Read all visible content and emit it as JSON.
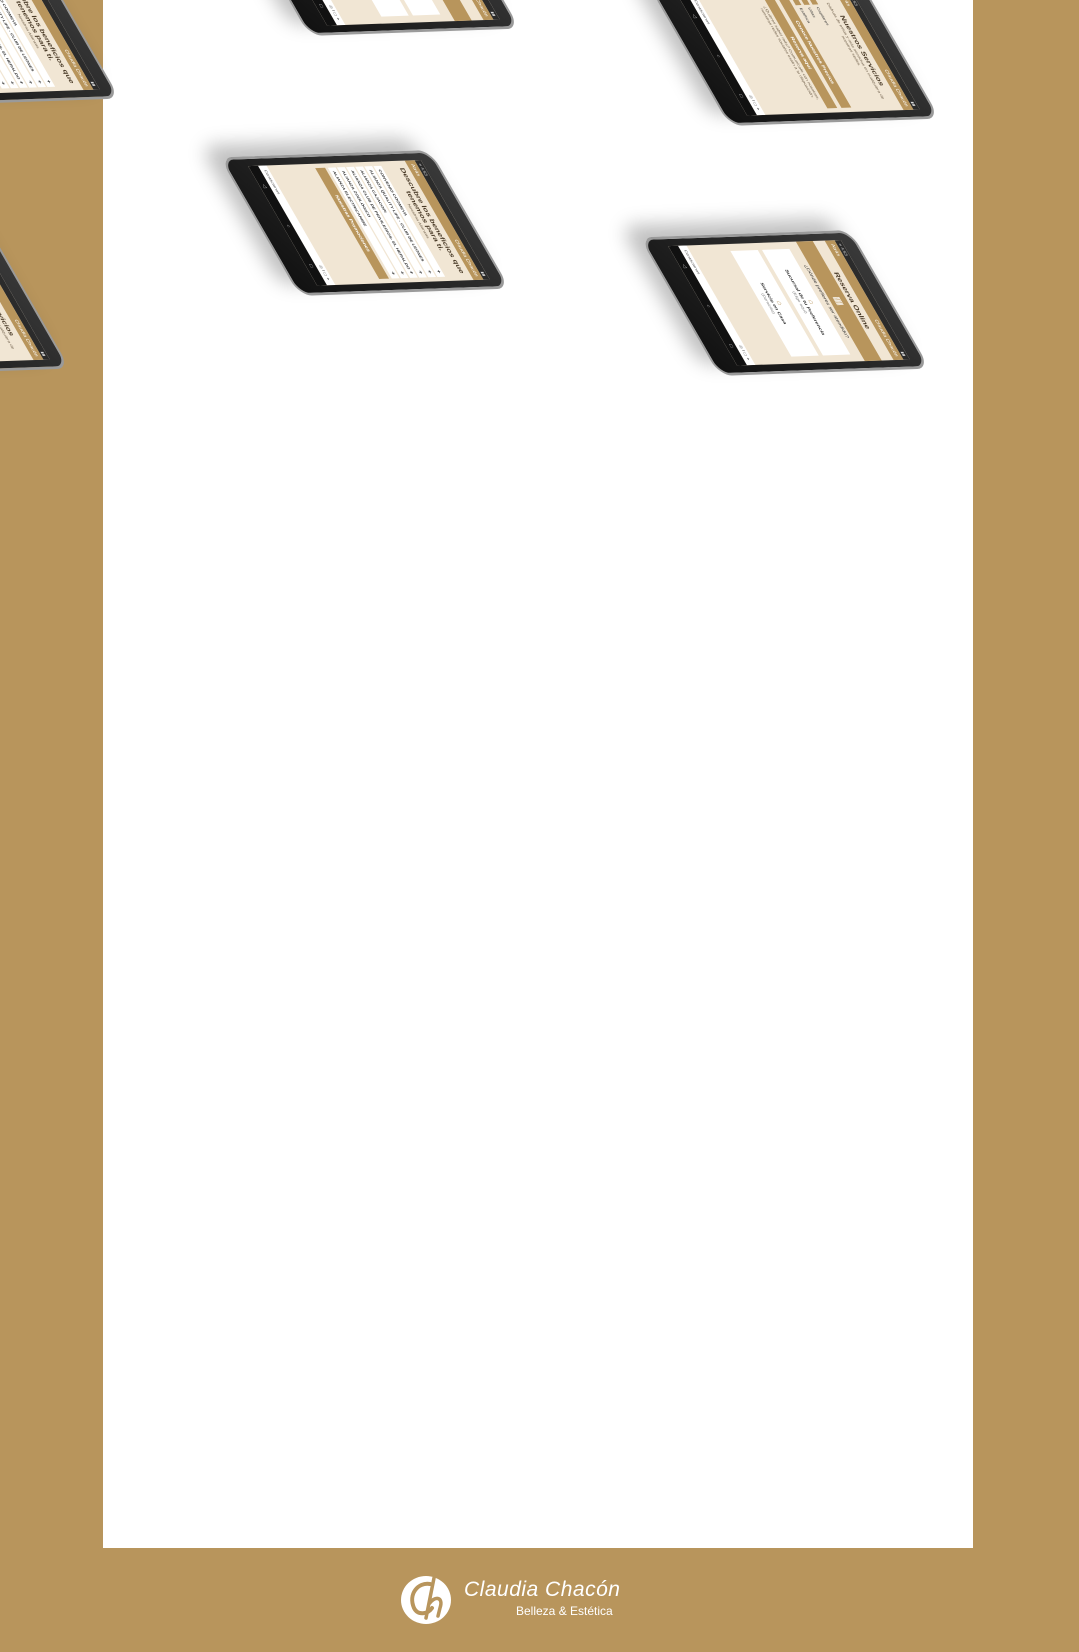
{
  "colors": {
    "brand": "#b8955c",
    "sheet": "#ffffff",
    "screen": "#f1e6d4"
  },
  "brand": {
    "name": "Claudia Chacón",
    "tagline": "Belleza & Estética",
    "short": "Claudia Chacón"
  },
  "common": {
    "back": "Atrás",
    "contact": "Contáctanos"
  },
  "beneficios": {
    "title": "Descubre los beneficios que tenemos para ti.",
    "subtitle": "Nuestras Alianzas",
    "items": [
      "CONVENIO COOMEVA",
      "ALIANZA QUALITY LIFE - CLUB DE LEONES",
      "ALIANZA CAJACOPI",
      "ALIANZA CLUB DE PRIVILEGIOS- EL HERALDO",
      "ALIANZA ZOOLÓGICO",
      "ALIANZA ELECTRICARIBE"
    ],
    "button": "Nuestras Promociones"
  },
  "reserva": {
    "title": "Reserva Online",
    "question": "¿Dónde prefieres ser atendido?",
    "option1": "Sucursal de tu Preferencia",
    "option1_sub": "(Elige aquí)",
    "option2": "Servicio en Casa",
    "option2_sub": "(Domicilio)"
  },
  "servicios": {
    "title": "Nuestros Servicios",
    "subtitle": "Disfruta de estos y más servicios en cualquiera de nuestras sedes.",
    "items": [
      "Capilares",
      "Uñas",
      "Estética"
    ],
    "button1": "Conoce Nuestros Precios",
    "button2": "Reserva aquí",
    "note": "¿Quieres saber más? Comunícate con nosotros, nuestras redes sociales están a tu disposición."
  }
}
